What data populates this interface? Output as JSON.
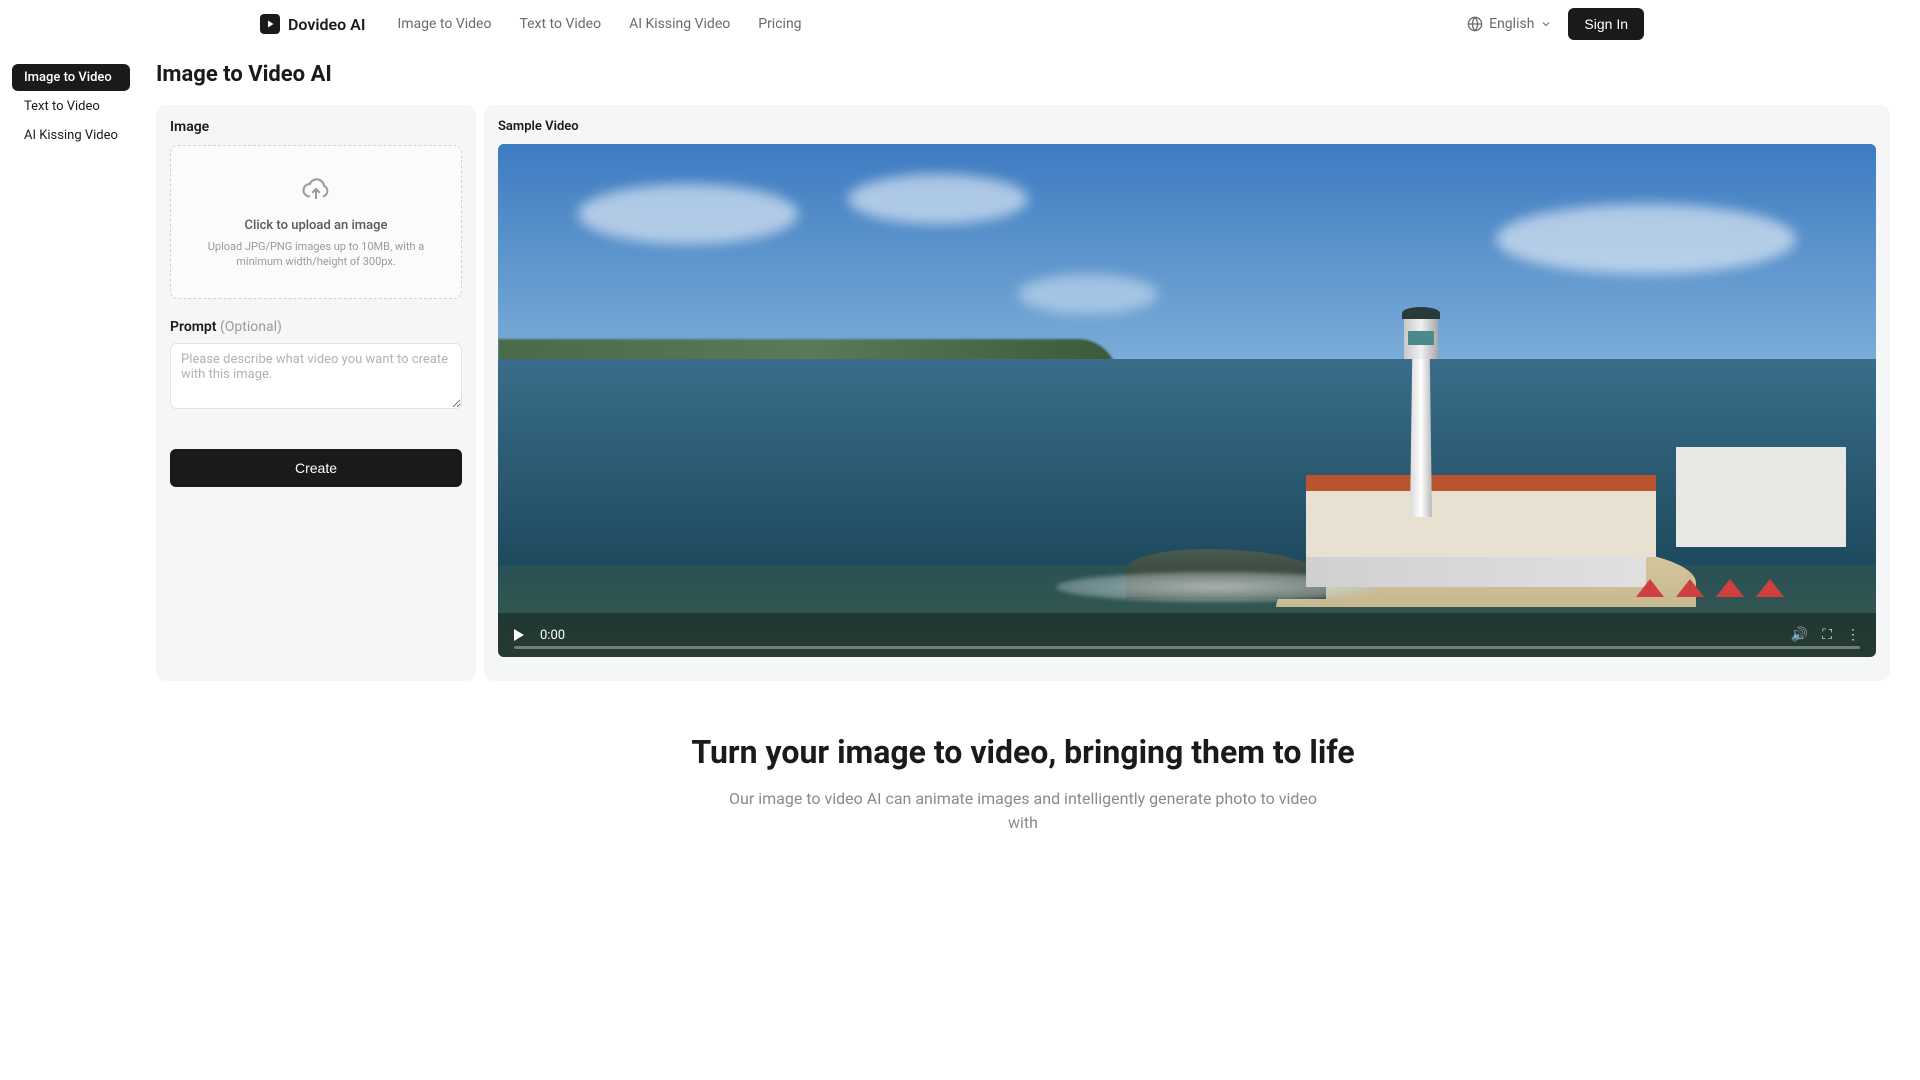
{
  "header": {
    "brand": "Dovideo AI",
    "nav": [
      "Image to Video",
      "Text to Video",
      "AI Kissing Video",
      "Pricing"
    ],
    "language": "English",
    "signin": "Sign In"
  },
  "sidebar": {
    "items": [
      "Image to Video",
      "Text to Video",
      "AI Kissing Video"
    ],
    "active_index": 0
  },
  "page": {
    "title": "Image to Video AI"
  },
  "left_panel": {
    "image_label": "Image",
    "upload_title": "Click to upload an image",
    "upload_sub": "Upload JPG/PNG images up to 10MB, with a minimum width/height of 300px.",
    "prompt_label": "Prompt",
    "prompt_optional": "(Optional)",
    "prompt_placeholder": "Please describe what video you want to create with this image.",
    "create_btn": "Create"
  },
  "right_panel": {
    "sample_label": "Sample Video",
    "time": "0:00"
  },
  "hero": {
    "title": "Turn your image to video, bringing them to life",
    "sub": "Our image to video AI can animate images and intelligently generate photo to video with"
  }
}
